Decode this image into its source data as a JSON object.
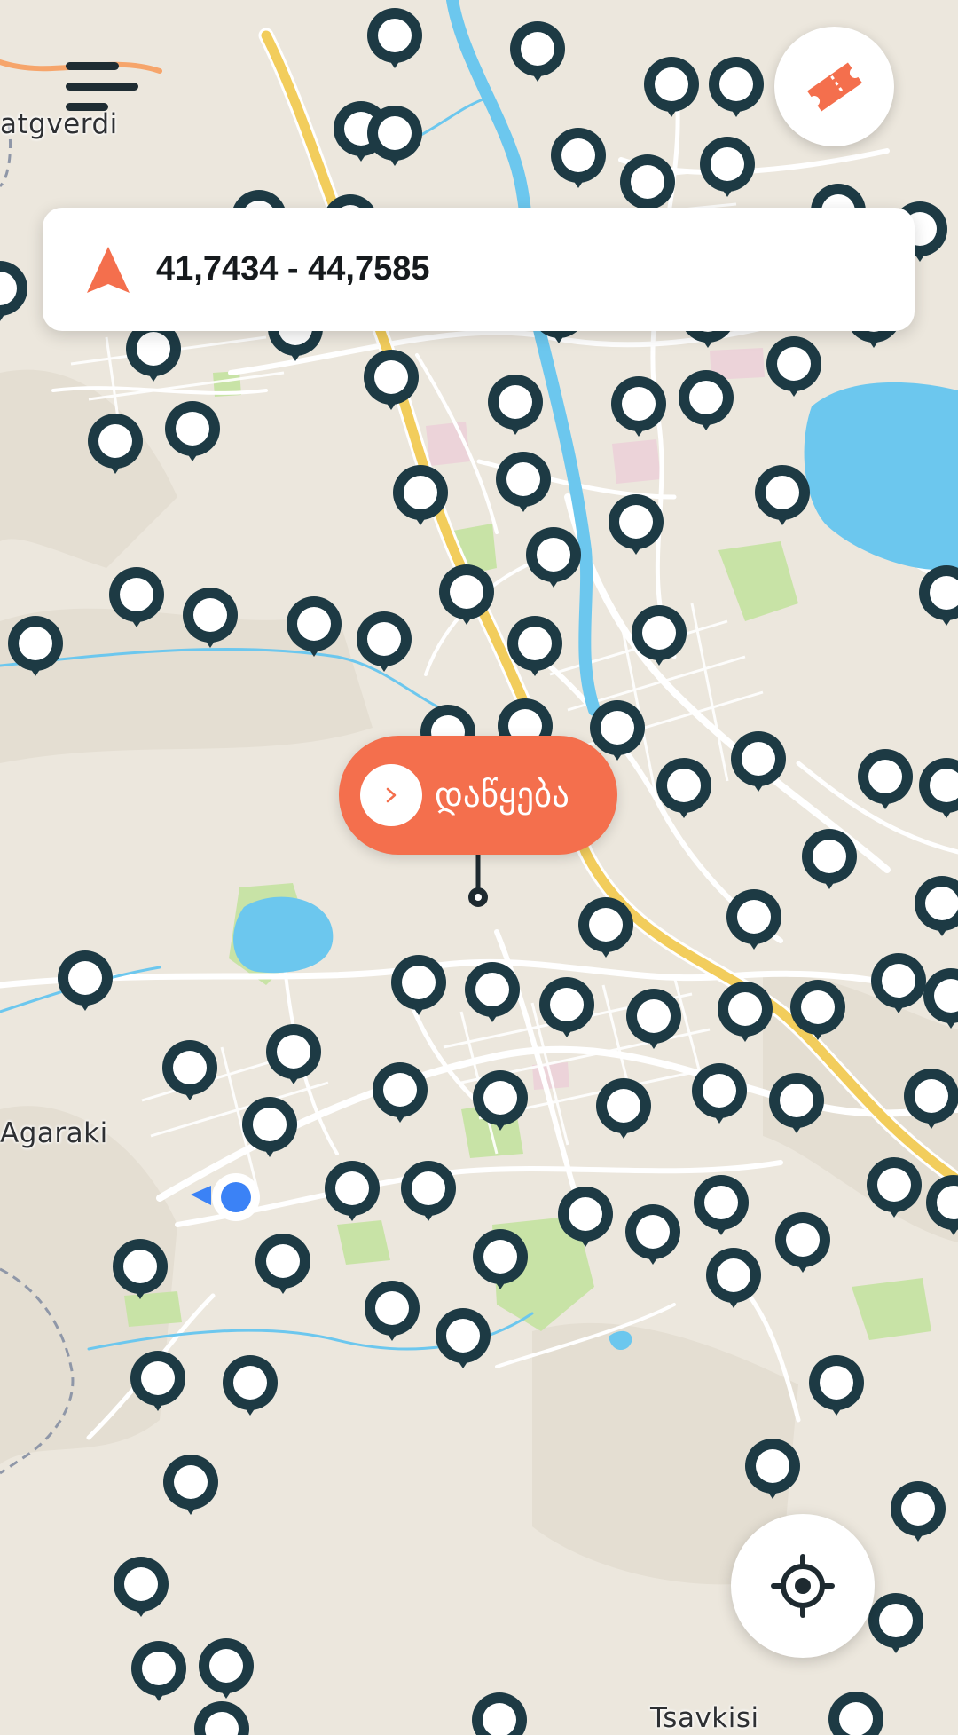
{
  "map": {
    "place_labels": [
      "atgverdi",
      "Agaraki",
      "Tsavkisi"
    ],
    "colors": {
      "background": "#ece7dd",
      "water": "#6cc7ee",
      "highway": "#f2cd5c",
      "park": "#c8e3a6",
      "road": "#ffffff",
      "pin": "#1d3a44",
      "pin_inner": "#ffffff",
      "user_location": "#3b82f6"
    }
  },
  "header": {
    "menu_icon": "hamburger-menu-icon",
    "ticket_icon": "ticket-icon",
    "accent_color": "#f46f4d"
  },
  "location_card": {
    "icon": "navigation-arrow-icon",
    "coordinates": "41,7434 - 44,7585"
  },
  "start_button": {
    "icon": "chevron-right-icon",
    "label": "დაწყება"
  },
  "locate_button": {
    "icon": "crosshair-target-icon"
  }
}
